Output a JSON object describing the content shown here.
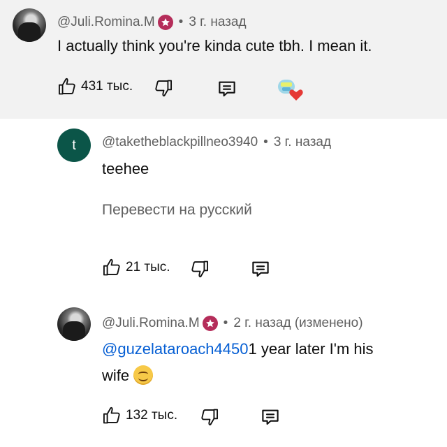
{
  "comments": [
    {
      "author": "@Juli.Romina.M",
      "time": "3 г. назад",
      "text": "I actually think you're kinda cute tbh. I mean it.",
      "likes": "431 тыс."
    },
    {
      "author": "@taketheblackpillneo3940",
      "avatar_letter": "t",
      "time": "3 г. назад",
      "text": "teehee",
      "translate": "Перевести на русский",
      "likes": "21 тыс."
    },
    {
      "author": "@Juli.Romina.M",
      "time": "2 г. назад (изменено)",
      "mention": "@guzelataroach4450",
      "text_after_mention": "1 year later I'm his",
      "text_line2": "wife",
      "emoji": "smiling-face-emoji",
      "likes": "132 тыс."
    }
  ],
  "colors": {
    "highlight_bg": "#f2f2f2",
    "avatar_letter_bg": "#0b5548",
    "badge": "#b52d5a",
    "mention": "#065fd4",
    "meta": "#5f5f5f"
  }
}
